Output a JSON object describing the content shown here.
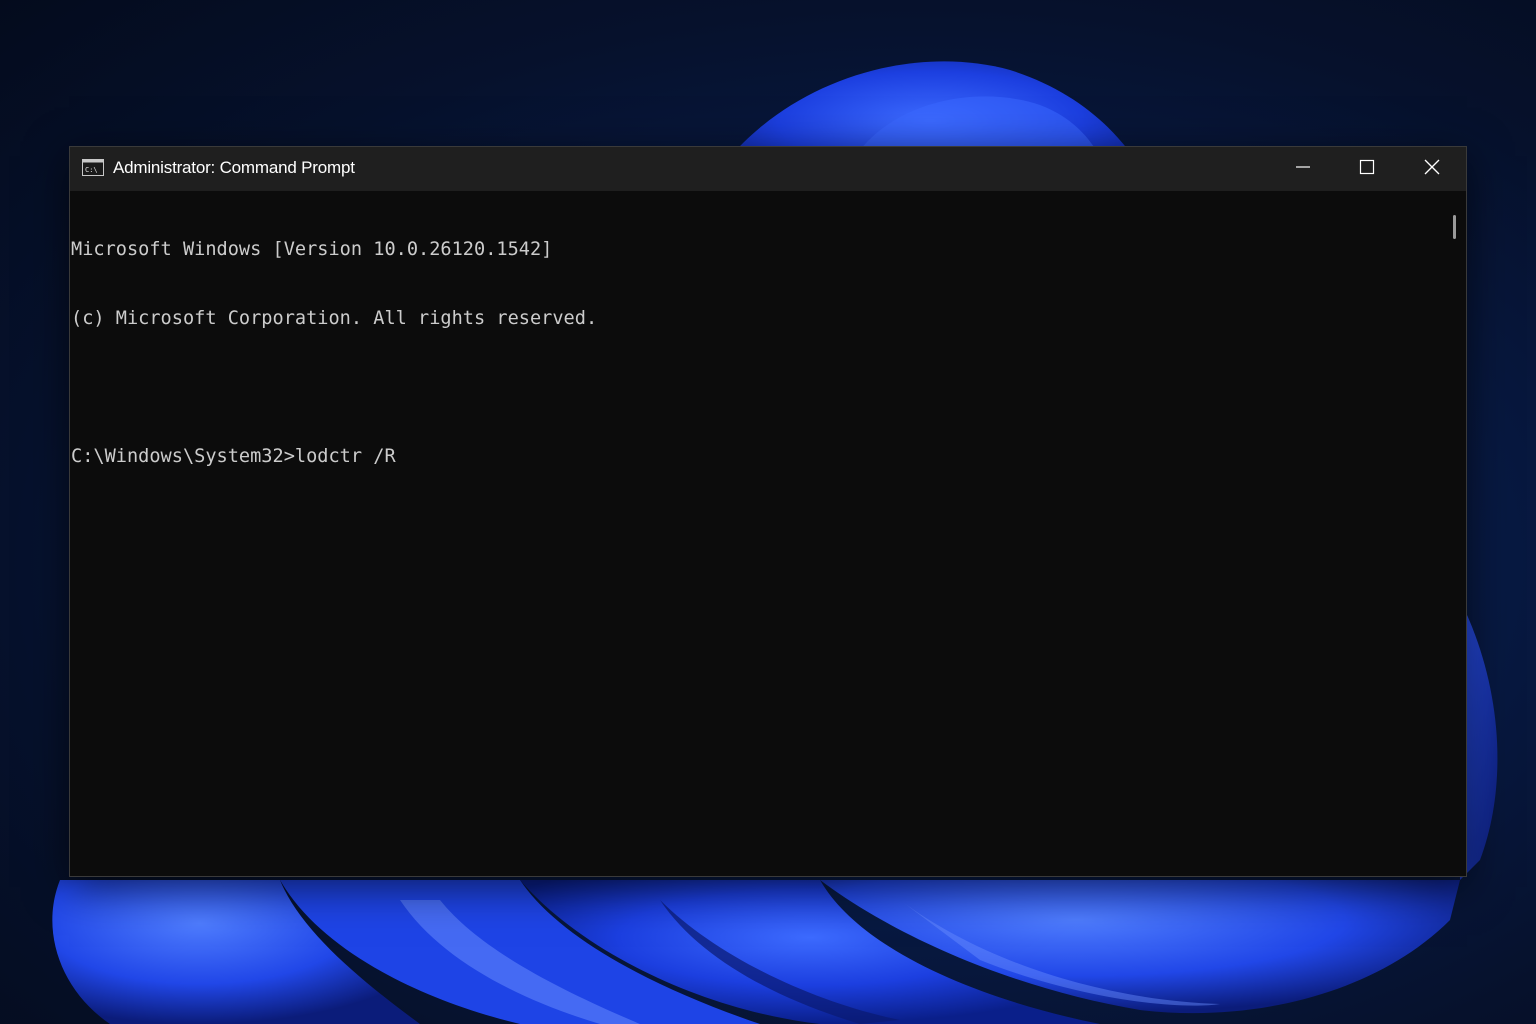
{
  "window": {
    "title": "Administrator: Command Prompt",
    "icon": "cmd-icon"
  },
  "caption_buttons": {
    "minimize": "minimize-icon",
    "maximize": "maximize-icon",
    "close": "close-icon"
  },
  "console": {
    "lines": [
      "Microsoft Windows [Version 10.0.26120.1542]",
      "(c) Microsoft Corporation. All rights reserved.",
      "",
      "C:\\Windows\\System32>lodctr /R"
    ]
  },
  "colors": {
    "console_background": "#0c0c0c",
    "console_text": "#cccccc",
    "titlebar": "#1f1f1f",
    "wallpaper_accent": "#1f4bff"
  }
}
